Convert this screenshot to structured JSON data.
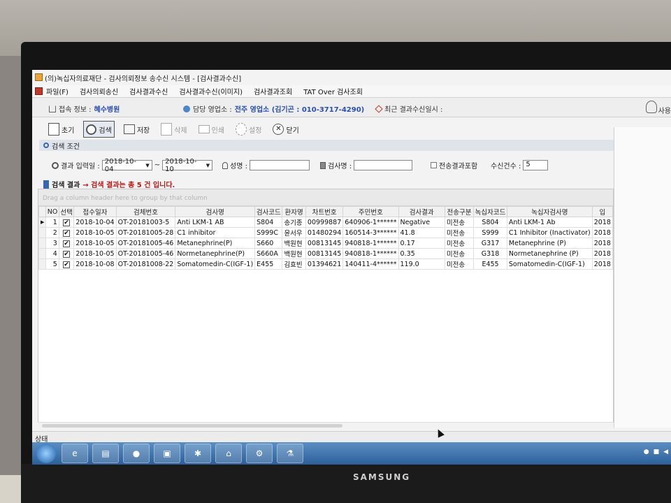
{
  "window": {
    "title": "(의)녹십자의료재단 - 검사의뢰정보 송수신 시스템 - [검사결과수신]"
  },
  "menu": [
    "파일(F)",
    "검사의뢰송신",
    "검사결과수신",
    "검사결과수신(이미지)",
    "검사결과조회",
    "TAT Over 검사조회"
  ],
  "info": {
    "conn_label": "접속 정보 :",
    "conn_value": "혜수병원",
    "branch_label": "담당 영업소 :",
    "branch_value": "전주 영업소 (김기곤 : 010-3717-4290)",
    "recent_label": "최근 결과수신일시 :",
    "user_label": "사용"
  },
  "toolbar": {
    "new": "초기",
    "search": "검색",
    "save": "저장",
    "delete": "삭제",
    "print": "인쇄",
    "settings": "설정",
    "close": "닫기"
  },
  "criteria": {
    "header": "검색 조건",
    "date_label": "결과 입력일 :",
    "date_from": "2018-10-04",
    "tilde": "~",
    "date_to": "2018-10-10",
    "name_label": "성명 :",
    "name_value": "",
    "test_label": "검사명 :",
    "test_value": "",
    "include_sent": "전송결과포함",
    "count_label": "수신건수 :",
    "count_value": "5"
  },
  "result": {
    "label": "검색 결과",
    "message": "→ 검색 결과는 총 5 건 입니다."
  },
  "grid": {
    "group_hint": "Drag a column header here to group by that column",
    "columns": [
      "NO",
      "선택",
      "접수일자",
      "검체번호",
      "검사명",
      "검사코드",
      "환자명",
      "차트번호",
      "주민번호",
      "검사결과",
      "전송구분",
      "녹십자코드",
      "녹십자검사명",
      "입"
    ],
    "rows": [
      [
        "1",
        "✔",
        "2018-10-04",
        "OT-20181003-5",
        "Anti LKM-1 AB",
        "S804",
        "송기종",
        "00999887",
        "640906-1******",
        "Negative",
        "미전송",
        "S804",
        "Anti LKM-1 Ab",
        "2018"
      ],
      [
        "2",
        "✔",
        "2018-10-05",
        "OT-20181005-28",
        "C1 inhibitor",
        "S999C",
        "윤서우",
        "01480294",
        "160514-3******",
        "41.8",
        "미전송",
        "S999",
        "C1 Inhibitor (Inactivator)",
        "2018"
      ],
      [
        "3",
        "✔",
        "2018-10-05",
        "OT-20181005-46",
        "Metanephrine(P)",
        "S660",
        "백원현",
        "00813145",
        "940818-1******",
        "0.17",
        "미전송",
        "G317",
        "Metanephrine (P)",
        "2018"
      ],
      [
        "4",
        "✔",
        "2018-10-05",
        "OT-20181005-46",
        "Normetanephrine(P)",
        "S660A",
        "백원현",
        "00813145",
        "940818-1******",
        "0.35",
        "미전송",
        "G318",
        "Normetanephrine (P)",
        "2018"
      ],
      [
        "5",
        "✔",
        "2018-10-08",
        "OT-20181008-22",
        "Somatomedin-C(IGF-1)",
        "E455",
        "김효빈",
        "01394621",
        "140411-4******",
        "119.0",
        "미전송",
        "E455",
        "Somatomedin-C(IGF-1)",
        "2018"
      ]
    ]
  },
  "status": {
    "label": "상태"
  },
  "monitor": {
    "brand": "SAMSUNG"
  },
  "taskbar": {
    "icons": [
      "internet-explorer-icon",
      "folder-icon",
      "media-icon",
      "app-icon",
      "medical-icon",
      "lab-icon",
      "tool-icon",
      "chemistry-icon"
    ]
  }
}
